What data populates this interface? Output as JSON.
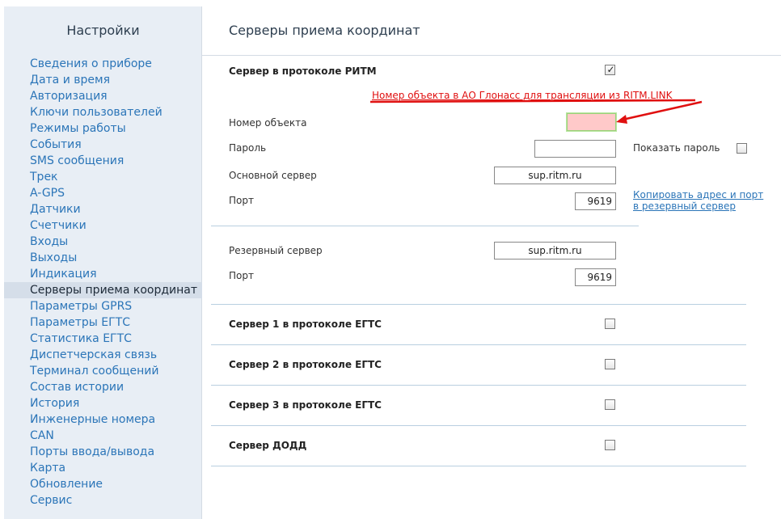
{
  "sidebar": {
    "title": "Настройки",
    "items": [
      "Сведения о приборе",
      "Дата и время",
      "Авторизация",
      "Ключи пользователей",
      "Режимы работы",
      "События",
      "SMS сообщения",
      "Трек",
      "A-GPS",
      "Датчики",
      "Счетчики",
      "Входы",
      "Выходы",
      "Индикация",
      "Серверы приема координат",
      "Параметры GPRS",
      "Параметры ЕГТС",
      "Статистика ЕГТС",
      "Диспетчерская связь",
      "Терминал сообщений",
      "Состав истории",
      "История",
      "Инженерные номера",
      "CAN",
      "Порты ввода/вывода",
      "Карта",
      "Обновление",
      "Сервис"
    ],
    "active_index": 14
  },
  "main": {
    "title": "Серверы приема координат",
    "ritm": {
      "label": "Сервер в протоколе РИТМ",
      "checked": true,
      "annotation": "Номер объекта в АО Глонасс для трансляции из RITM.LINK",
      "object_number_label": "Номер объекта",
      "object_number_value": "",
      "password_label": "Пароль",
      "password_value": "",
      "show_password_label": "Показать пароль",
      "main_server_label": "Основной сервер",
      "main_server_value": "sup.ritm.ru",
      "port_label": "Порт",
      "port_value": "9619",
      "copy_link_line1": "Копировать адрес и порт",
      "copy_link_line2": "в резервный сервер"
    },
    "backup": {
      "server_label": "Резервный сервер",
      "server_value": "sup.ritm.ru",
      "port_label": "Порт",
      "port_value": "9619"
    },
    "egts1": {
      "label": "Сервер 1 в протоколе ЕГТС",
      "checked": false
    },
    "egts2": {
      "label": "Сервер 2 в протоколе ЕГТС",
      "checked": false
    },
    "egts3": {
      "label": "Сервер 3 в протоколе ЕГТС",
      "checked": false
    },
    "dodd": {
      "label": "Сервер ДОДД",
      "checked": false
    },
    "colors": {
      "annotation": "#e01010",
      "link": "#2b75b8",
      "highlight": "#ffc9c9"
    }
  }
}
